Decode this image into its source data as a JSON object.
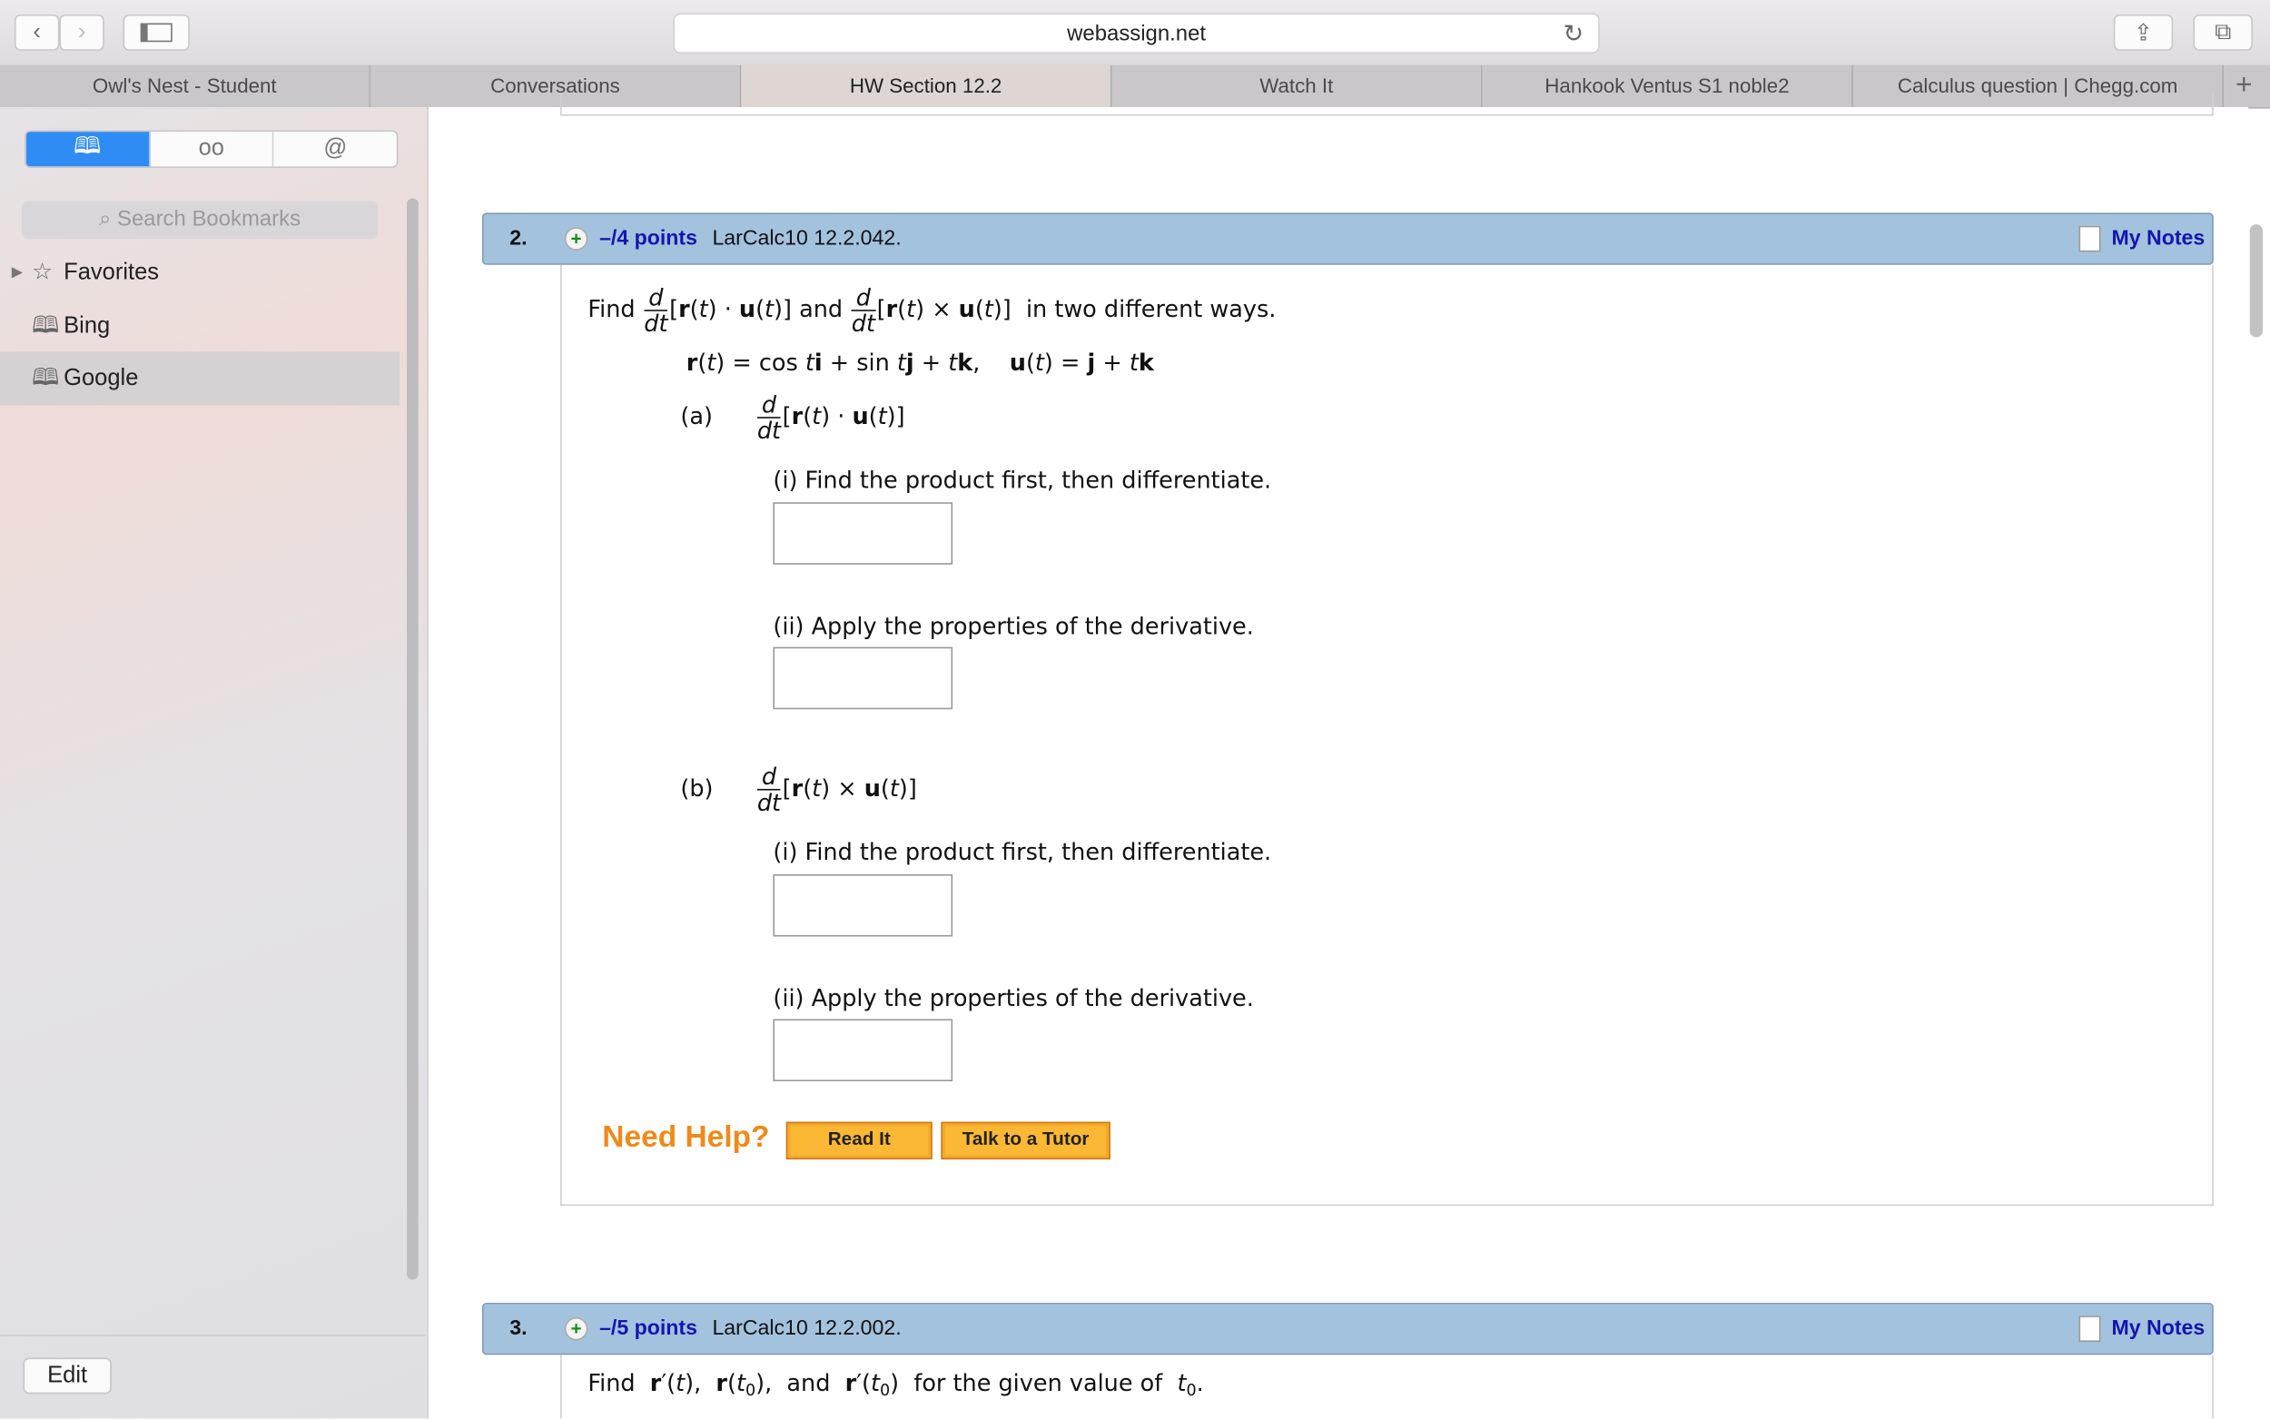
{
  "browser": {
    "url": "webassign.net",
    "tabs": [
      {
        "label": "Owl's Nest - Student",
        "active": false
      },
      {
        "label": "Conversations",
        "active": false
      },
      {
        "label": "HW Section 12.2",
        "active": true
      },
      {
        "label": "Watch It",
        "active": false
      },
      {
        "label": "Hankook Ventus S1 noble2",
        "active": false
      },
      {
        "label": "Calculus question | Chegg.com",
        "active": false
      }
    ],
    "new_tab": "+"
  },
  "sidebar": {
    "search_placeholder": "Search Bookmarks",
    "items": [
      {
        "label": "Favorites",
        "icon": "star-icon"
      },
      {
        "label": "Bing",
        "icon": "book-icon"
      },
      {
        "label": "Google",
        "icon": "book-icon",
        "selected": true
      }
    ],
    "edit_label": "Edit"
  },
  "q2": {
    "number": "2.",
    "points": "–/4 points",
    "id": "LarCalc10 12.2.042.",
    "notes": "My Notes",
    "find": "Find",
    "and": "and",
    "ways": "in two different ways.",
    "a_label": "(a)",
    "b_label": "(b)",
    "i_text": "(i) Find the product first, then differentiate.",
    "ii_text": "(ii) Apply the properties of the derivative.",
    "answers": [
      "",
      "",
      "",
      ""
    ],
    "need_help": "Need Help?",
    "read_it": "Read It",
    "tutor": "Talk to a Tutor"
  },
  "q3": {
    "number": "3.",
    "points": "–/5 points",
    "id": "LarCalc10 12.2.002.",
    "notes": "My Notes",
    "find": "Find",
    "rest": "for the given value of"
  },
  "colors": {
    "header": "#a3c2de",
    "points": "#1515b0",
    "help": "#ef8a1a",
    "button": "#fbb834",
    "accent": "#2f8cf4"
  }
}
